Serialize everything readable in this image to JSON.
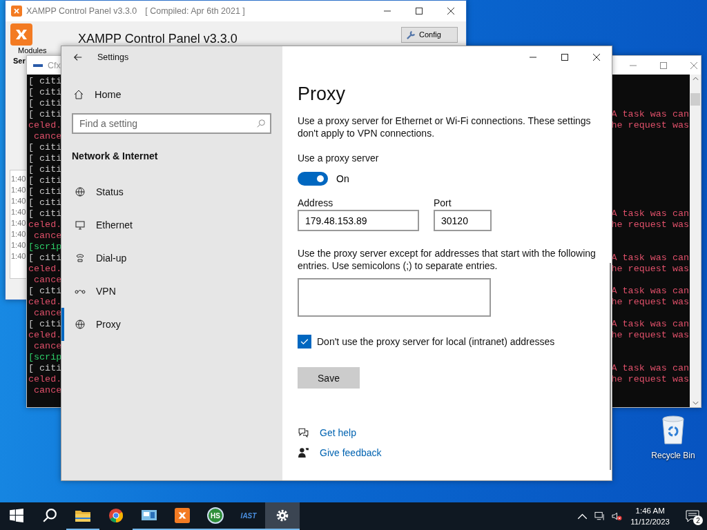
{
  "xampp": {
    "title": "XAMPP Control Panel v3.3.0",
    "compiled": "[ Compiled: Apr 6th 2021 ]",
    "heading": "XAMPP Control Panel v3.3.0",
    "config_button": "Config",
    "modules_label": "Modules",
    "column_1": "Ser",
    "log_times": [
      "1:40",
      "1:40",
      "1:40",
      "1:40",
      "1:40",
      "1:40",
      "1:40",
      "1:40"
    ]
  },
  "console": {
    "title": "Cfx",
    "rows": [
      {
        "left": {
          "text": "[ citi",
          "kind": "info"
        }
      },
      {
        "left": {
          "text": "[ citi",
          "kind": "info"
        }
      },
      {
        "left": {
          "text": "[ citi",
          "kind": "info"
        }
      },
      {
        "left": {
          "text": "[ citi",
          "kind": "info"
        },
        "right": {
          "text": "A task was can",
          "kind": "error"
        }
      },
      {
        "left": {
          "text": "celed.",
          "kind": "error"
        },
        "right": {
          "text": "he request was",
          "kind": "error"
        }
      },
      {
        "left": {
          "text": " cance",
          "kind": "error"
        }
      },
      {
        "left": {
          "text": "[ citi",
          "kind": "info"
        }
      },
      {
        "left": {
          "text": "[ citi",
          "kind": "info"
        }
      },
      {
        "left": {
          "text": "[ citi",
          "kind": "info"
        }
      },
      {
        "left": {
          "text": "[ citi",
          "kind": "info"
        }
      },
      {
        "left": {
          "text": "[ citi",
          "kind": "info"
        }
      },
      {
        "left": {
          "text": "[ citi",
          "kind": "info"
        }
      },
      {
        "left": {
          "text": "[ citi",
          "kind": "info"
        },
        "right": {
          "text": "A task was can",
          "kind": "error"
        }
      },
      {
        "left": {
          "text": "celed.",
          "kind": "error"
        },
        "right": {
          "text": "he request was",
          "kind": "error"
        }
      },
      {
        "left": {
          "text": " cance",
          "kind": "error"
        }
      },
      {
        "left": {
          "text": "[scrip",
          "kind": "script"
        }
      },
      {
        "left": {
          "text": "[ citi",
          "kind": "info"
        },
        "right": {
          "text": "A task was can",
          "kind": "error"
        }
      },
      {
        "left": {
          "text": "celed.",
          "kind": "error"
        },
        "right": {
          "text": "he request was",
          "kind": "error"
        }
      },
      {
        "left": {
          "text": " cance",
          "kind": "error"
        }
      },
      {
        "left": {
          "text": "[ citi",
          "kind": "info"
        },
        "right": {
          "text": "A task was can",
          "kind": "error"
        }
      },
      {
        "left": {
          "text": "celed.",
          "kind": "error"
        },
        "right": {
          "text": "he request was",
          "kind": "error"
        }
      },
      {
        "left": {
          "text": " cance",
          "kind": "error"
        }
      },
      {
        "left": {
          "text": "[ citi",
          "kind": "info"
        },
        "right": {
          "text": "A task was can",
          "kind": "error"
        }
      },
      {
        "left": {
          "text": "celed.",
          "kind": "error"
        },
        "right": {
          "text": "he request was",
          "kind": "error"
        }
      },
      {
        "left": {
          "text": " cance",
          "kind": "error"
        }
      },
      {
        "left": {
          "text": "[scrip",
          "kind": "script"
        }
      },
      {
        "left": {
          "text": "[ citi",
          "kind": "info"
        },
        "right": {
          "text": "A task was can",
          "kind": "error"
        }
      },
      {
        "left": {
          "text": "celed.",
          "kind": "error"
        },
        "right": {
          "text": "he request was",
          "kind": "error"
        }
      },
      {
        "left": {
          "text": " cance",
          "kind": "error"
        }
      }
    ]
  },
  "settings": {
    "title": "Settings",
    "home": "Home",
    "search": {
      "placeholder": "Find a setting"
    },
    "section": "Network & Internet",
    "sidebar": {
      "items": [
        {
          "label": "Status",
          "kind": "status",
          "selected": false
        },
        {
          "label": "Ethernet",
          "kind": "ethernet",
          "selected": false
        },
        {
          "label": "Dial-up",
          "kind": "dialup",
          "selected": false
        },
        {
          "label": "VPN",
          "kind": "vpn",
          "selected": false
        },
        {
          "label": "Proxy",
          "kind": "proxy",
          "selected": true
        }
      ]
    },
    "proxy": {
      "title": "Proxy",
      "description": "Use a proxy server for Ethernet or Wi-Fi connections. These settings don't apply to VPN connections.",
      "use_proxy": {
        "label": "Use a proxy server",
        "on": true,
        "state_label": "On"
      },
      "address": {
        "label": "Address",
        "value": "179.48.153.89"
      },
      "port": {
        "label": "Port",
        "value": "30120"
      },
      "exceptions_description": "Use the proxy server except for addresses that start with the following entries. Use semicolons (;) to separate entries.",
      "bypass_local": {
        "label": "Don't use the proxy server for local (intranet) addresses",
        "checked": true
      },
      "save_button": "Save",
      "links": [
        {
          "label": "Get help",
          "kind": "help"
        },
        {
          "label": "Give feedback",
          "kind": "feedback"
        }
      ]
    }
  },
  "desktop_icons": [
    {
      "label": "Recycle Bin"
    }
  ],
  "taskbar": {
    "apps": [
      {
        "kind": "folder",
        "running": true,
        "selected": false
      },
      {
        "kind": "chrome",
        "running": false,
        "selected": false
      },
      {
        "kind": "monitor",
        "running": true,
        "selected": false
      },
      {
        "kind": "xampp",
        "running": true,
        "selected": false
      },
      {
        "kind": "badge",
        "label": "HS",
        "running": true,
        "selected": false
      },
      {
        "kind": "wordmark",
        "label": "IAST",
        "running": true,
        "selected": false
      },
      {
        "kind": "gear",
        "running": true,
        "selected": true
      }
    ],
    "time": "1:46 AM",
    "date": "11/12/2023",
    "notifications": "2"
  }
}
